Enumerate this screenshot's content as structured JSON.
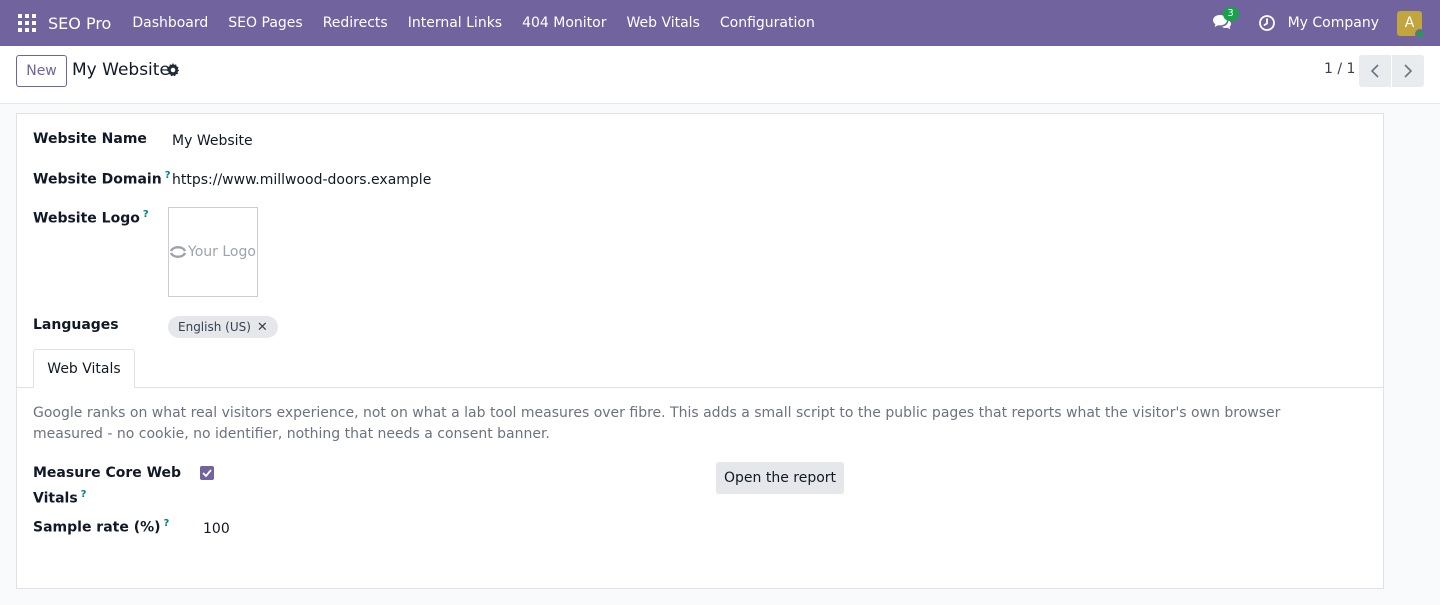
{
  "navbar": {
    "app_name": "SEO Pro",
    "menu": [
      "Dashboard",
      "SEO Pages",
      "Redirects",
      "Internal Links",
      "404 Monitor",
      "Web Vitals",
      "Configuration"
    ],
    "chat_count": "3",
    "company": "My Company",
    "avatar_letter": "A",
    "colors": {
      "bar": "#71639e",
      "badge": "#16a34a",
      "avatar": "#c1a640"
    }
  },
  "control_panel": {
    "new_label": "New",
    "record_title": "My Website",
    "pager_text": "1 / 1"
  },
  "form": {
    "website_name_label": "Website Name",
    "website_name_value": "My Website",
    "website_domain_label": "Website Domain",
    "website_domain_value": "https://www.millwood-doors.example",
    "website_logo_label": "Website Logo",
    "logo_text": "Your Logo",
    "languages_label": "Languages",
    "language_tag": "English (US)",
    "help_mark": "?",
    "tab_label": "Web Vitals",
    "tab_description": "Google ranks on what real visitors experience, not on what a lab tool measures over fibre. This adds a small script to the public pages that reports what the visitor's own browser measured - no cookie, no identifier, nothing that needs a consent banner.",
    "measure_label_line1": "Measure Core Web",
    "measure_label_line2": "Vitals",
    "measure_checked": true,
    "open_report_label": "Open the report",
    "sample_rate_label": "Sample rate (%)",
    "sample_rate_value": "100"
  }
}
